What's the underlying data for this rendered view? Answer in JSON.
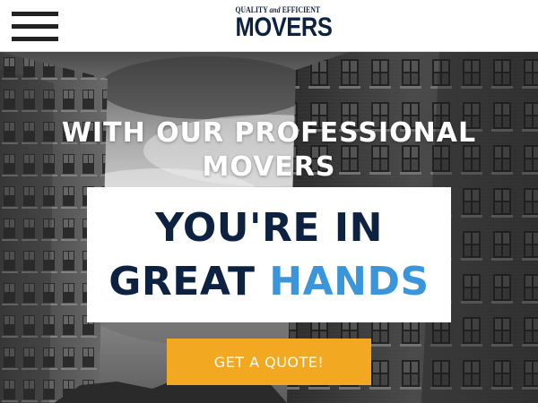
{
  "header": {
    "logo_top_pre": "QUALITY",
    "logo_top_and": "and",
    "logo_top_post": "EFFICIENT",
    "logo_main": "MOVERS"
  },
  "hero": {
    "subheading_line1": "WITH OUR PROFESSIONAL",
    "subheading_line2": "MOVERS",
    "headline_line1": "YOU'RE IN",
    "headline_line2_dark": "GREAT",
    "headline_line2_accent": "HANDS",
    "cta_label": "GET A QUOTE!"
  },
  "colors": {
    "brand_navy": "#0d2240",
    "accent_blue": "#3a95da",
    "cta_orange": "#f2a821"
  }
}
